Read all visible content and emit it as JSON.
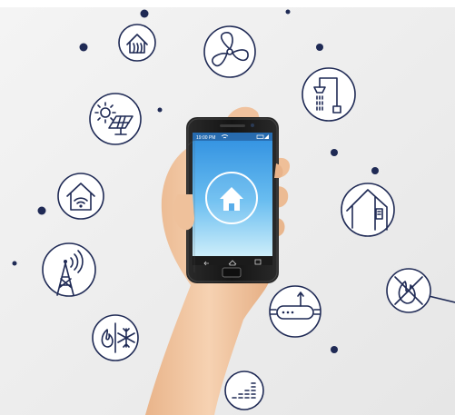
{
  "phone": {
    "status_time": "19:00 PM",
    "screen_icon": "house-icon",
    "nav_icons": [
      "back-icon",
      "home-icon",
      "recent-apps-icon"
    ]
  },
  "icons": [
    "thermostat-house-icon",
    "fan-icon",
    "shower-icon",
    "solar-panel-icon",
    "wifi-house-icon",
    "house-meter-icon",
    "antenna-tower-icon",
    "no-gas-icon",
    "router-icon",
    "heat-cool-icon",
    "equalizer-icon"
  ],
  "colors": {
    "background": "#ececec",
    "icon_stroke": "#1f2a55",
    "screen_top": "#2f8fe0",
    "screen_bottom": "#cdeefa",
    "phone_body": "#1a1a1a",
    "skin": "#f1c6a0"
  }
}
